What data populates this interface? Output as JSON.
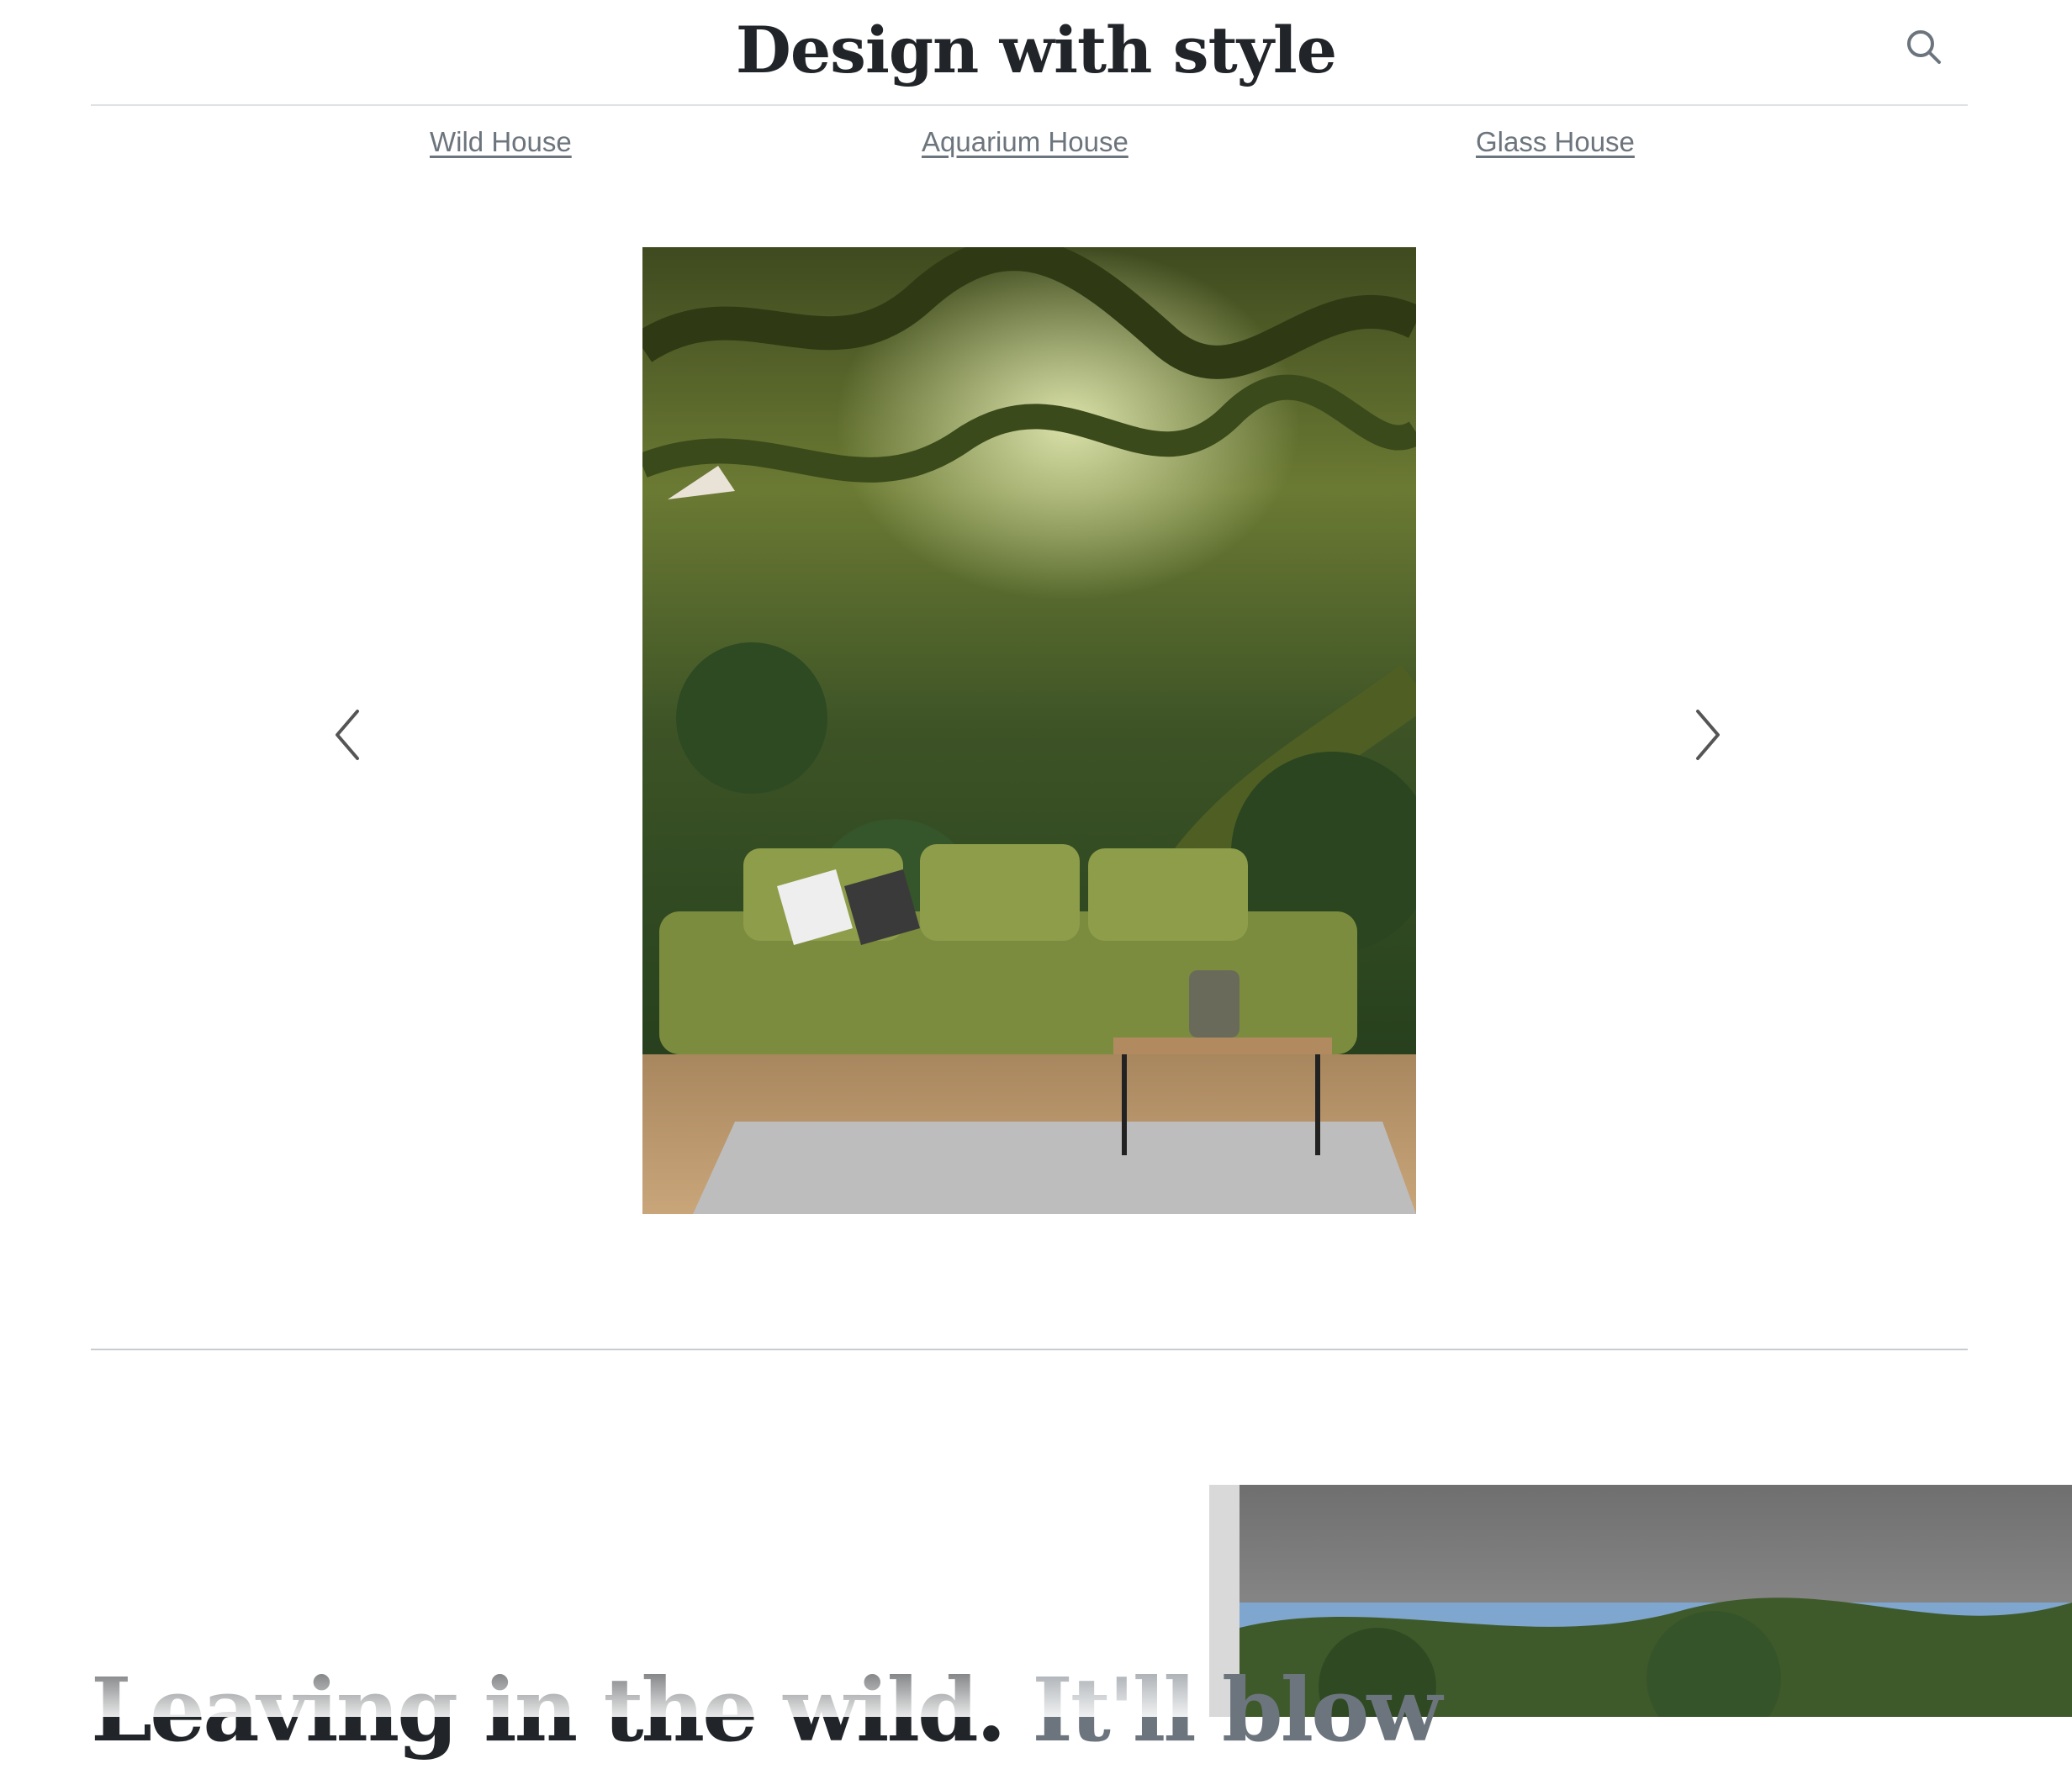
{
  "header": {
    "site_title": "Design with style",
    "search_icon": "search-icon"
  },
  "nav": {
    "links": [
      {
        "label": "Wild House"
      },
      {
        "label": "Aquarium House"
      },
      {
        "label": "Glass House"
      }
    ]
  },
  "carousel": {
    "slide_description": "jungle-living-room",
    "prev_icon": "chevron-left-icon",
    "next_icon": "chevron-right-icon"
  },
  "feature": {
    "heading_main": "Leaving in the wild.",
    "heading_muted": "It'll blow"
  }
}
